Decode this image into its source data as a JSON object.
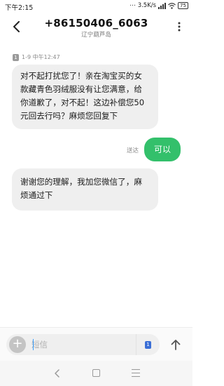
{
  "status_bar": {
    "time": "下午2:15",
    "network_speed": "3.5K/s",
    "battery": "75"
  },
  "header": {
    "contact_number": "+86150406_6063",
    "contact_location": "辽宁葫芦岛"
  },
  "conversation": {
    "meta": {
      "sim_slot": "1",
      "timestamp": "1-9 中午12:47"
    },
    "messages": [
      {
        "direction": "incoming",
        "text": "对不起打扰您了！亲在淘宝买的女款藏青色羽绒服没有让您满意，给你道歉了，对不起！这边补偿您50元回去行吗？麻烦您回复下"
      },
      {
        "direction": "outgoing",
        "text": "可以",
        "status": "送达"
      },
      {
        "direction": "incoming",
        "text": "谢谢您的理解，我加您微信了，麻烦通过下"
      }
    ]
  },
  "composer": {
    "placeholder": "短信",
    "sim_slot": "1"
  },
  "icons": {
    "back": "arrow-left-icon",
    "more": "more-vertical-icon",
    "add": "plus-icon",
    "send": "arrow-up-icon",
    "nav_back": "chevron-left-icon",
    "nav_home": "square-icon",
    "nav_menu": "menu-icon"
  },
  "colors": {
    "outgoing_bubble": "#33c06b",
    "incoming_bubble": "#efefef",
    "sim_badge_active": "#3b6fd6"
  }
}
